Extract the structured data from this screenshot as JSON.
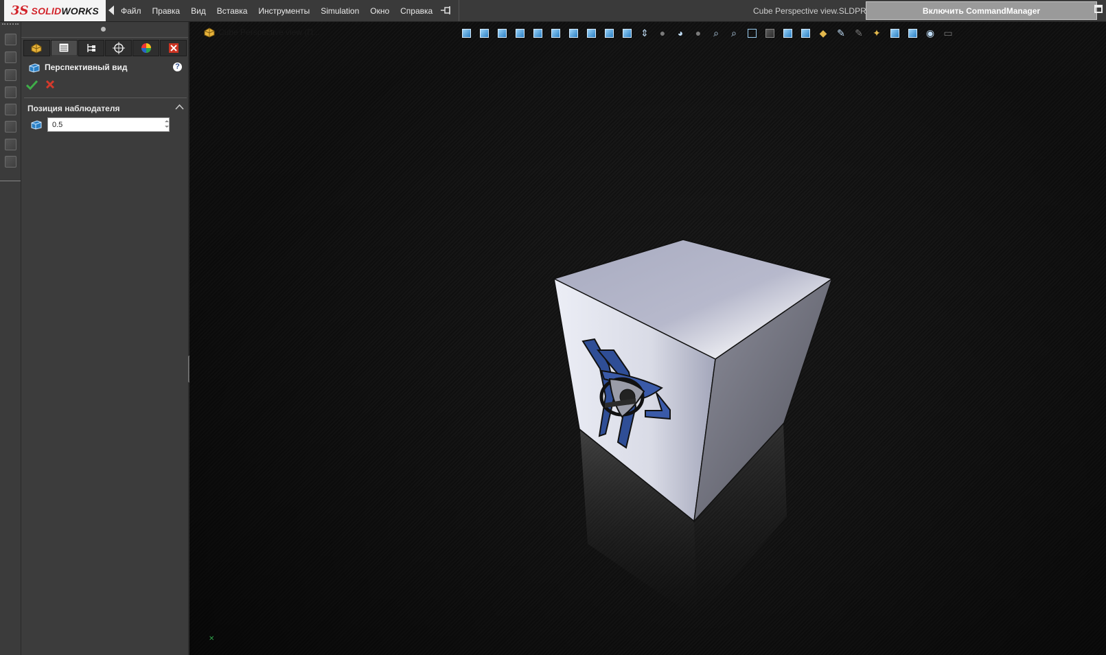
{
  "app": {
    "logo_ds": "3S",
    "logo_solid": "SOLID",
    "logo_works": "WORKS"
  },
  "menu": [
    "Файл",
    "Правка",
    "Вид",
    "Вставка",
    "Инструменты",
    "Simulation",
    "Окно",
    "Справка"
  ],
  "titlebar": {
    "document_title": "Cube Perspective view.SLDPRT",
    "command_manager_button": "Включить CommandManager"
  },
  "property_manager": {
    "tabs": [
      "feature-manager-tab",
      "property-manager-tab",
      "configuration-manager-tab",
      "dimxpert-manager-tab",
      "display-manager-tab",
      "custom-tab"
    ],
    "title": "Перспективный вид",
    "group_title": "Позиция наблюдателя",
    "observer_position_value": "0.5"
  },
  "viewport": {
    "tree_root_label": "Cube Perspective view  (П..."
  },
  "colors": {
    "accent_red": "#d2232a",
    "ok_green": "#3fae49",
    "cancel_red": "#d33a2c",
    "toolbar_blue": "#2a7fc4"
  },
  "heads_up_toolbar": [
    "front-view-icon",
    "back-view-icon",
    "left-view-icon",
    "right-view-icon",
    "top-view-icon",
    "bottom-view-icon",
    "isometric-view-icon",
    "trimetric-view-icon",
    "dimetric-view-icon",
    "normal-to-icon",
    "view-selector-icon",
    "zoom-to-fit-icon",
    "zoom-to-area-icon",
    "previous-view-icon",
    "section-view-icon",
    "display-style-icon",
    "hidden-lines-icon",
    "shaded-icon",
    "shaded-with-edges-icon",
    "apply-scene-icon",
    "edit-appearance-icon",
    "view-settings-icon",
    "realview-icon",
    "perspective-icon",
    "rotate-view-icon",
    "hide-show-items-icon",
    "cameras-icon",
    "display-pane-icon"
  ]
}
